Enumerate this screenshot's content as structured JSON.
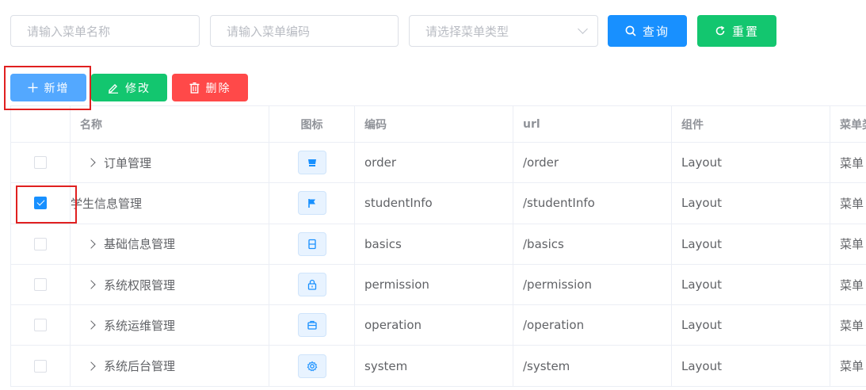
{
  "search": {
    "name_placeholder": "请输入菜单名称",
    "code_placeholder": "请输入菜单编码",
    "type_placeholder": "请选择菜单类型",
    "query_label": "查询",
    "reset_label": "重置"
  },
  "toolbar": {
    "add_label": "新增",
    "edit_label": "修改",
    "delete_label": "删除"
  },
  "table": {
    "headers": {
      "name": "名称",
      "icon": "图标",
      "code": "编码",
      "url": "url",
      "component": "组件",
      "type": "菜单类型"
    },
    "rows": [
      {
        "name": "订单管理",
        "icon": "shop-icon",
        "code": "order",
        "url": "/order",
        "component": "Layout",
        "type": "菜单",
        "expandable": true,
        "checked": false
      },
      {
        "name": "学生信息管理",
        "icon": "flag-icon",
        "code": "studentInfo",
        "url": "/studentInfo",
        "component": "Layout",
        "type": "菜单",
        "expandable": false,
        "checked": true
      },
      {
        "name": "基础信息管理",
        "icon": "document-icon",
        "code": "basics",
        "url": "/basics",
        "component": "Layout",
        "type": "菜单",
        "expandable": true,
        "checked": false
      },
      {
        "name": "系统权限管理",
        "icon": "lock-icon",
        "code": "permission",
        "url": "/permission",
        "component": "Layout",
        "type": "菜单",
        "expandable": true,
        "checked": false
      },
      {
        "name": "系统运维管理",
        "icon": "briefcase-icon",
        "code": "operation",
        "url": "/operation",
        "component": "Layout",
        "type": "菜单",
        "expandable": true,
        "checked": false
      },
      {
        "name": "系统后台管理",
        "icon": "gear-icon",
        "code": "system",
        "url": "/system",
        "component": "Layout",
        "type": "菜单",
        "expandable": true,
        "checked": false
      }
    ]
  },
  "colors": {
    "primary": "#1890ff",
    "success": "#13c66f",
    "danger": "#ff4949",
    "highlight": "#e02020"
  }
}
